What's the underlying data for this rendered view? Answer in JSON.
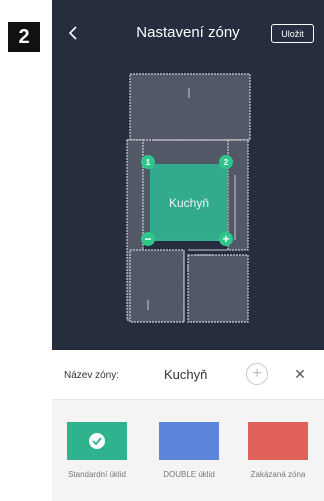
{
  "step": "2",
  "header": {
    "title": "Nastavení zóny",
    "save_label": "Uložit"
  },
  "zone": {
    "label": "Kuchyň",
    "handles": [
      "1",
      "2",
      "−",
      "+"
    ]
  },
  "name_row": {
    "label": "Název zóny:",
    "value": "Kuchyň",
    "add_icon": "+",
    "close_icon": "✕"
  },
  "types": [
    {
      "label": "Standardní úklid",
      "color": "#2fb38f",
      "selected": true
    },
    {
      "label": "DOUBLE úklid",
      "color": "#5b86d9",
      "selected": false
    },
    {
      "label": "Zakázaná zóna",
      "color": "#e0615c",
      "selected": false
    }
  ],
  "colors": {
    "map_background": "#262d3f",
    "map_floor": "#525866",
    "accent": "#2fb38f"
  }
}
